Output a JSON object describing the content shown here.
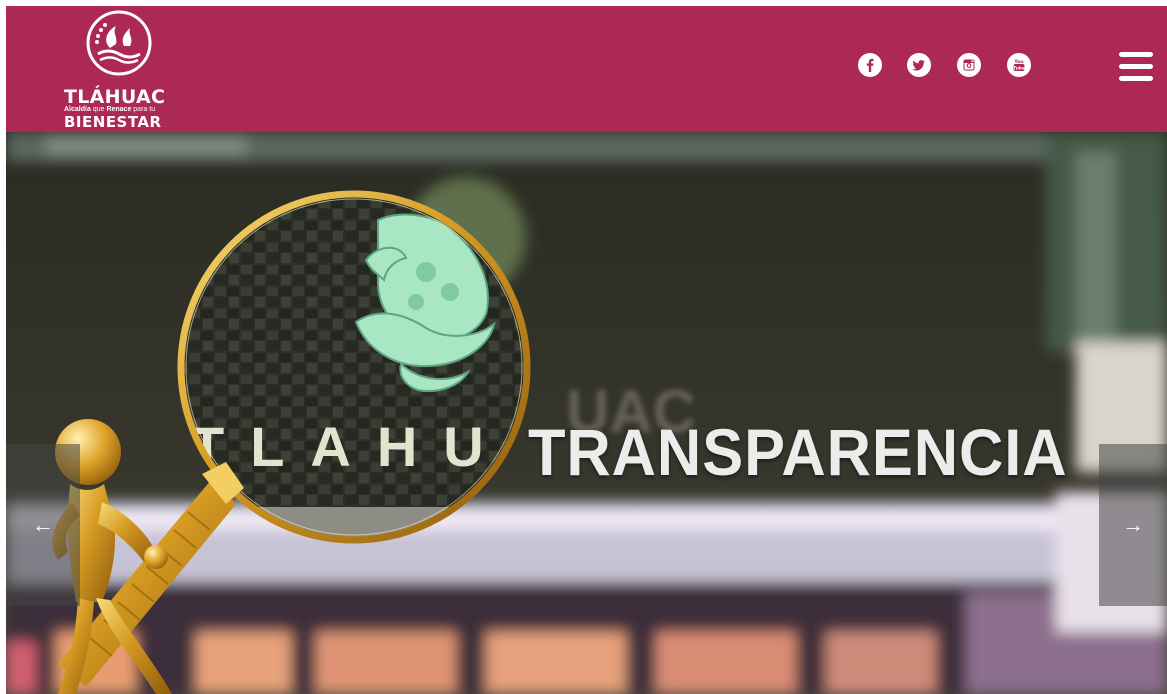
{
  "site": {
    "logo": {
      "title": "TLÁHUAC",
      "tagline_pre": "Alcaldía",
      "tagline_mid": " que ",
      "tagline_bold": "Renace",
      "tagline_post": " para tu",
      "subtitle": "BIENESTAR"
    },
    "brand_color": "#ad2955",
    "social": [
      {
        "name": "facebook-icon",
        "glyph": "f"
      },
      {
        "name": "twitter-icon",
        "glyph": "bird"
      },
      {
        "name": "instagram-icon",
        "glyph": "camera"
      },
      {
        "name": "youtube-icon",
        "glyph": "You Tube"
      }
    ],
    "menu_icon": "hamburger-menu-icon"
  },
  "hero": {
    "title": "TRANSPARENCIA",
    "building_sign": "TLAHUAC",
    "magnifier_text": "TLAHU",
    "prev_label": "←",
    "next_label": "→"
  }
}
